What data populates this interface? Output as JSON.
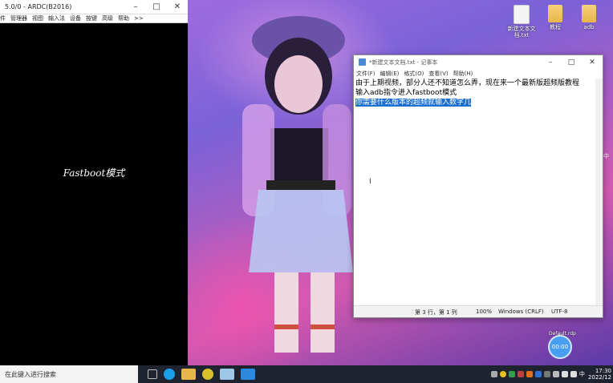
{
  "rdc": {
    "title": "5.0/0 - ARDC(B2016)",
    "menu": [
      "件",
      "管理器",
      "视图",
      "输入法",
      "设备",
      "按键",
      "高级",
      "帮助",
      ">>"
    ],
    "screen_text": "Fastboot模式"
  },
  "desktop": {
    "icons": [
      {
        "label": "新建文本文\n档.txt",
        "icon": "text-file-icon"
      },
      {
        "label": "教程",
        "icon": "folder-icon"
      },
      {
        "label": "adb",
        "icon": "folder-icon"
      }
    ],
    "right_clip_text": "中",
    "defaultrdp_label": "Default.rdp",
    "float_button_label": "00:00"
  },
  "notepad": {
    "title": "*新建文本文档.txt - 记事本",
    "menu": [
      "文件(F)",
      "编辑(E)",
      "格式(O)",
      "查看(V)",
      "帮助(H)"
    ],
    "lines": [
      "由于上期视频，部分人还不知道怎么弄，现在来一个最新版超频版教程",
      "输入adb指令进入fastboot模式",
      "你需要什么版本的超频就输入数字几"
    ],
    "selected_line_index": 2,
    "status": {
      "position": "第 3 行，第 1 列",
      "zoom": "100%",
      "eol": "Windows (CRLF)",
      "encoding": "UTF-8"
    }
  },
  "taskbar": {
    "search_placeholder": "在此键入进行搜索",
    "clock_time": "17:30",
    "clock_date": "2022/12",
    "ime": "中"
  }
}
